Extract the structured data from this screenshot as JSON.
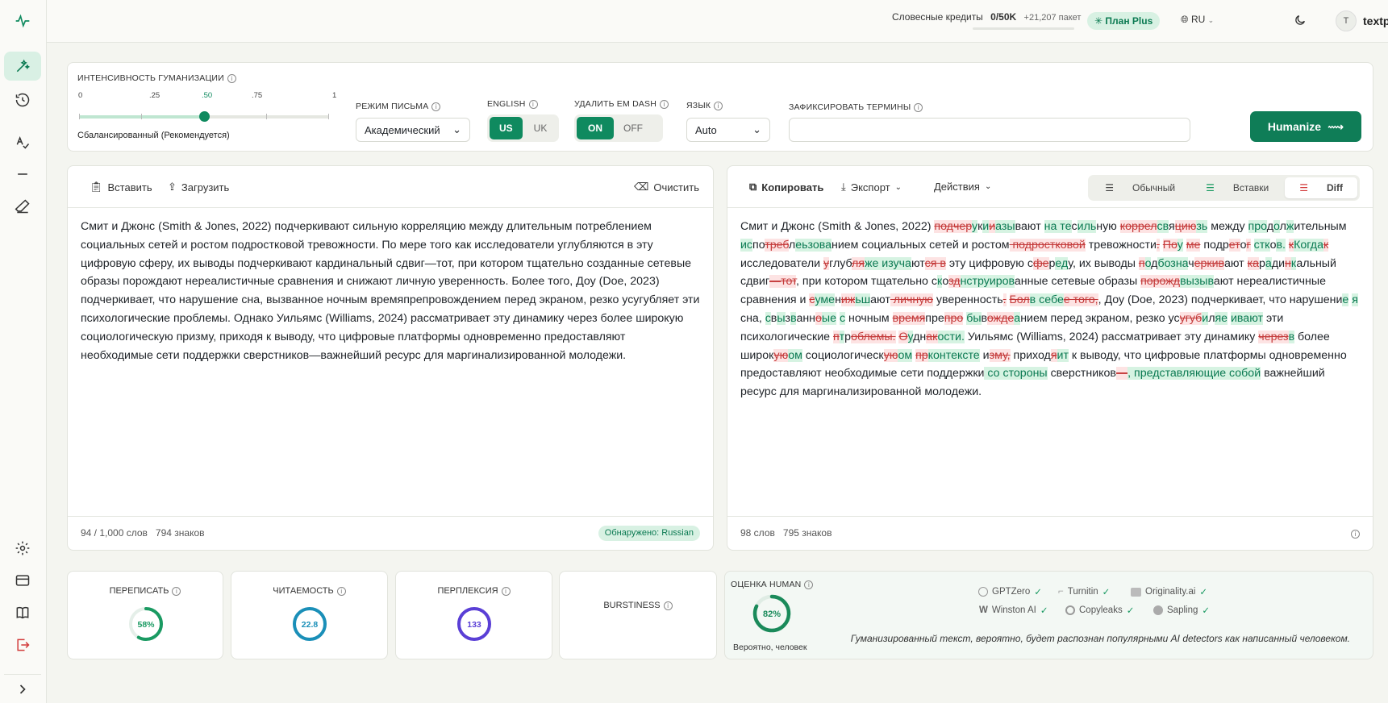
{
  "topbar": {
    "credits_label": "Словесные кредиты",
    "credits_value": "0/50K",
    "credits_pack": "+21,207 пакет",
    "plan": "План Plus",
    "lang": "RU",
    "username": "textpulse",
    "avatar_letter": "T"
  },
  "settings": {
    "intensity_label": "Интенсивность гуманизации",
    "ticks": [
      "0",
      ".25",
      ".50",
      ".75",
      "1"
    ],
    "intensity_value": 0.5,
    "intensity_caption": "Сбалансированный (Рекомендуется)",
    "mode_label": "Режим письма",
    "mode_value": "Академический",
    "english_label": "English",
    "english_options": [
      "US",
      "UK"
    ],
    "emdash_label": "Удалить EM DASH",
    "emdash_options": [
      "ON",
      "OFF"
    ],
    "language_label": "Язык",
    "language_value": "Auto",
    "terms_label": "Зафиксировать термины",
    "humanize_button": "Humanize"
  },
  "input_editor": {
    "paste": "Вставить",
    "upload": "Загрузить",
    "clear": "Очистить",
    "text": "Смит и Джонс (Smith & Jones, 2022) подчеркивают сильную корреляцию между длительным потреблением социальных сетей и ростом подростковой тревожности. По мере того как исследователи углубляются в эту цифровую сферу, их выводы подчеркивают кардинальный сдвиг—тот, при котором тщательно созданные сетевые образы порождают нереалистичные сравнения и снижают личную уверенность. Более того, Доу (Doe, 2023) подчеркивает, что нарушение сна, вызванное ночным времяпрепровождением перед экраном, резко усугубляет эти психологические проблемы. Однако Уильямс (Williams, 2024) рассматривает эту динамику через более широкую социологическую призму, приходя к выводу, что цифровые платформы одновременно предоставляют необходимые сети поддержки сверстников—важнейший ресурс для маргинализированной молодежи.",
    "words": "94 / 1,000 слов",
    "chars": "794 знаков",
    "detected": "Обнаружено: Russian"
  },
  "output_editor": {
    "copy": "Копировать",
    "export": "Экспорт",
    "actions": "Действия",
    "views": [
      "Обычный",
      "Вставки",
      "Diff"
    ],
    "words": "98 слов",
    "chars": "795 знаков"
  },
  "metrics": {
    "rewrite": {
      "label": "Переписать",
      "value": "58%",
      "pct": 58,
      "color": "#1a9a62"
    },
    "readability": {
      "label": "Читаемость",
      "value": "22.8",
      "pct": 100,
      "color": "#1a8fb8"
    },
    "perplexity": {
      "label": "Перплексия",
      "value": "133",
      "pct": 100,
      "color": "#5a3fd6"
    },
    "burstiness": {
      "label": "Burstiness"
    },
    "human": {
      "label": "Оценка Human",
      "value": "82%",
      "pct": 82,
      "color": "#1a8a5a",
      "caption": "Вероятно, человек"
    }
  },
  "detectors": [
    "GPTZero",
    "Turnitin",
    "Originality.ai",
    "Winston AI",
    "Copyleaks",
    "Sapling"
  ],
  "detector_note": "Гуманизированный текст, вероятно, будет распознан популярными AI detectors как написанный человеком."
}
